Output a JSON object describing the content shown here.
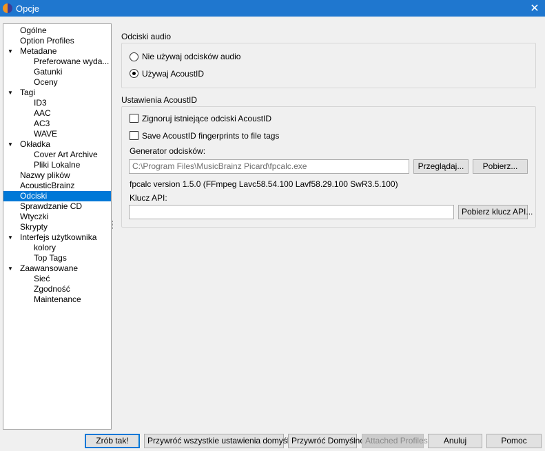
{
  "window": {
    "title": "Opcje",
    "close_glyph": "✕"
  },
  "tree": {
    "items": [
      {
        "label": "Ogólne",
        "level": 0,
        "expanded": null
      },
      {
        "label": "Option Profiles",
        "level": 0,
        "expanded": null
      },
      {
        "label": "Metadane",
        "level": 0,
        "expanded": true
      },
      {
        "label": "Preferowane wyda...",
        "level": 1,
        "expanded": null
      },
      {
        "label": "Gatunki",
        "level": 1,
        "expanded": null
      },
      {
        "label": "Oceny",
        "level": 1,
        "expanded": null
      },
      {
        "label": "Tagi",
        "level": 0,
        "expanded": true
      },
      {
        "label": "ID3",
        "level": 1,
        "expanded": null
      },
      {
        "label": "AAC",
        "level": 1,
        "expanded": null
      },
      {
        "label": "AC3",
        "level": 1,
        "expanded": null
      },
      {
        "label": "WAVE",
        "level": 1,
        "expanded": null
      },
      {
        "label": "Okładka",
        "level": 0,
        "expanded": true
      },
      {
        "label": "Cover Art Archive",
        "level": 1,
        "expanded": null
      },
      {
        "label": "Pliki Lokalne",
        "level": 1,
        "expanded": null
      },
      {
        "label": "Nazwy plików",
        "level": 0,
        "expanded": null
      },
      {
        "label": "AcousticBrainz",
        "level": 0,
        "expanded": null
      },
      {
        "label": "Odciski",
        "level": 0,
        "expanded": null,
        "selected": true
      },
      {
        "label": "Sprawdzanie CD",
        "level": 0,
        "expanded": null
      },
      {
        "label": "Wtyczki",
        "level": 0,
        "expanded": null
      },
      {
        "label": "Skrypty",
        "level": 0,
        "expanded": null
      },
      {
        "label": "Interfejs użytkownika",
        "level": 0,
        "expanded": true
      },
      {
        "label": "kolory",
        "level": 1,
        "expanded": null
      },
      {
        "label": "Top Tags",
        "level": 1,
        "expanded": null
      },
      {
        "label": "Zaawansowane",
        "level": 0,
        "expanded": true
      },
      {
        "label": "Sieć",
        "level": 1,
        "expanded": null
      },
      {
        "label": "Zgodność",
        "level": 1,
        "expanded": null
      },
      {
        "label": "Maintenance",
        "level": 1,
        "expanded": null
      }
    ]
  },
  "audio_fingerprints": {
    "title": "Odciski audio",
    "option_none": "Nie używaj odcisków audio",
    "option_acoustid": "Używaj AcoustID",
    "selected": "acoustid"
  },
  "acoustid": {
    "title": "Ustawienia AcoustID",
    "ignore_existing": "Zignoruj istniejące odciski AcoustID",
    "ignore_existing_checked": false,
    "save_fingerprints": "Save AcoustID fingerprints to file tags",
    "save_fingerprints_checked": false,
    "generator_label": "Generator odcisków:",
    "generator_path": "C:\\Program Files\\MusicBrainz Picard\\fpcalc.exe",
    "browse_button": "Przeglądaj...",
    "download_button": "Pobierz...",
    "version_text": "fpcalc version 1.5.0 (FFmpeg Lavc58.54.100 Lavf58.29.100 SwR3.5.100)",
    "api_key_label": "Klucz API:",
    "api_key_value": "",
    "get_api_key_button": "Pobierz klucz API..."
  },
  "footer": {
    "ok": "Zrób tak!",
    "restore_all": "Przywróć wszystkie ustawienia domyślne",
    "restore_defaults": "Przywróć Domyślne",
    "attached_profiles": "Attached Profiles",
    "cancel": "Anuluj",
    "help": "Pomoc"
  },
  "colors": {
    "titlebar": "#1f77cf",
    "selection": "#0078d7"
  }
}
